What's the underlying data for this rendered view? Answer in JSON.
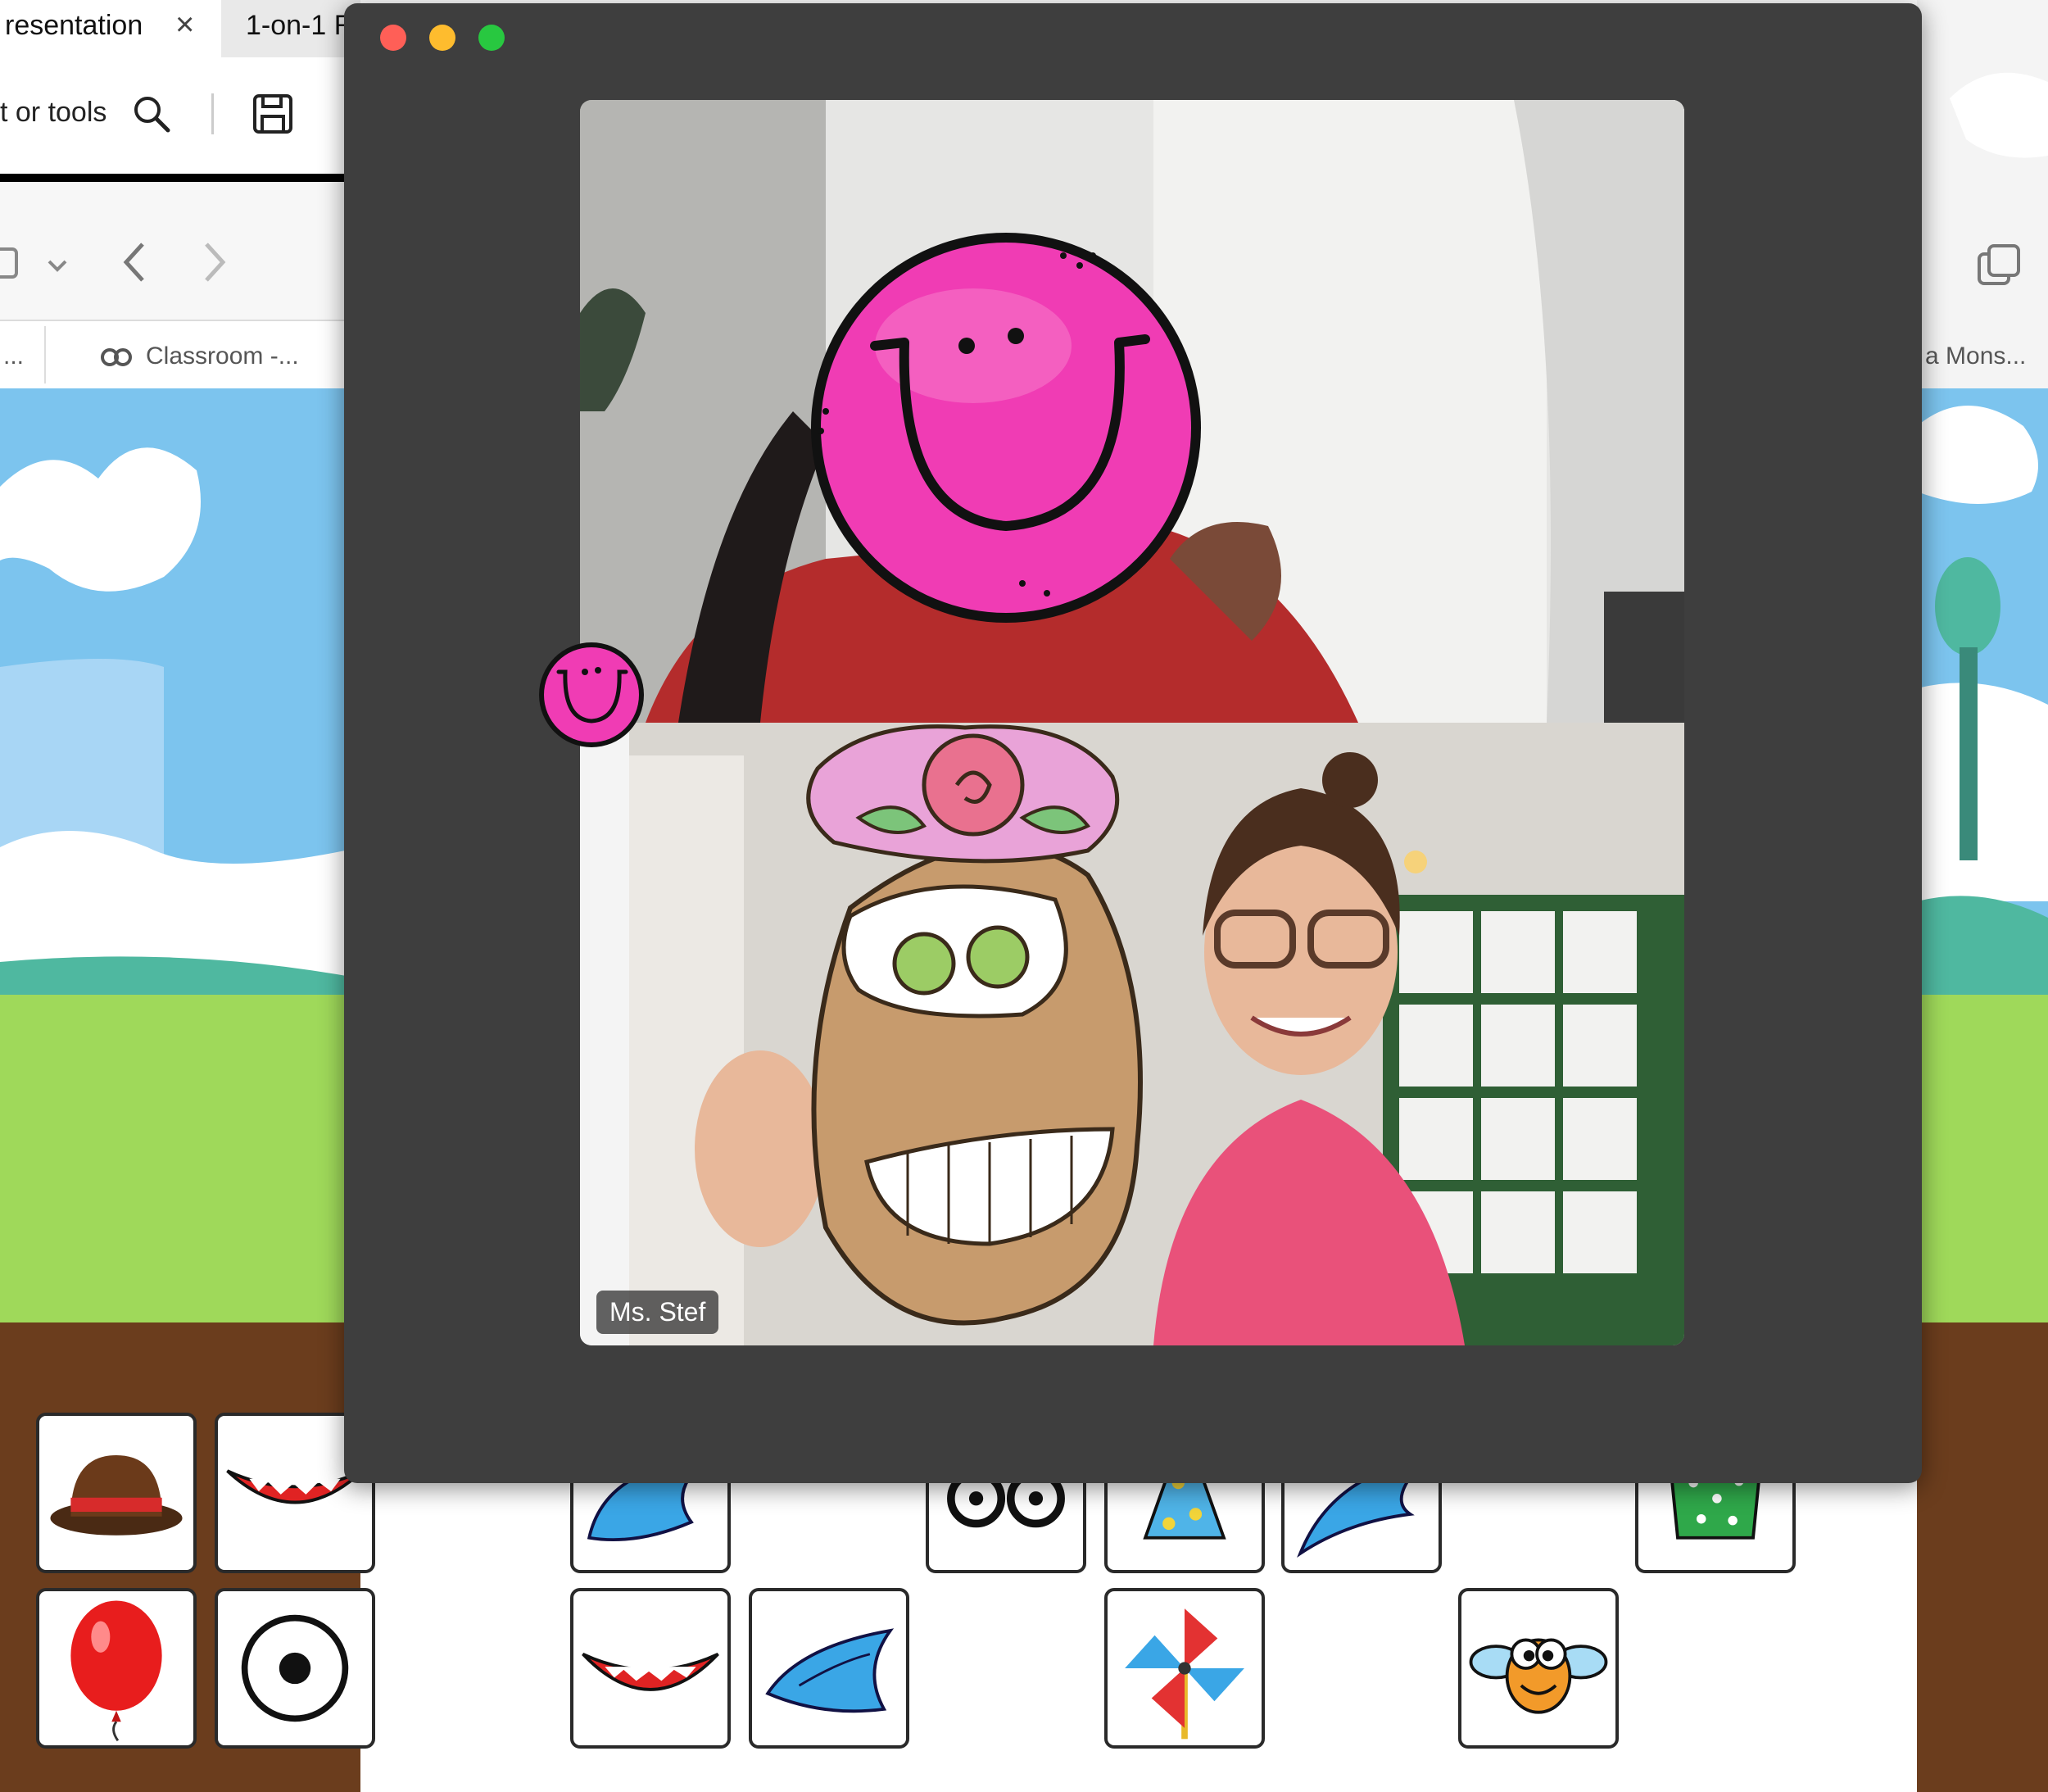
{
  "browser_left": {
    "tabs": [
      {
        "label": "resentation",
        "active": true
      },
      {
        "label": "1-on-1 R"
      }
    ],
    "search_text": "t or tools",
    "bookmark": "Classroom -...",
    "bookmark_prefix": "..."
  },
  "browser_right": {
    "bookmark": "a Mons..."
  },
  "call": {
    "participant_bottom": {
      "name": "Ms. Stef"
    }
  },
  "tray_items": [
    "bowler-hat-icon",
    "monster-mouth-icon",
    "blue-fin-icon",
    "glasses-icon",
    "party-hat-icon",
    "blue-wing-icon",
    "green-pot-icon",
    "red-balloon-icon",
    "eye-icon",
    "monster-mouth-icon",
    "blue-fin-icon",
    "pinwheel-icon",
    "bug-face-icon"
  ],
  "colors": {
    "window_bg": "#3e3e3e",
    "close": "#ff5f57",
    "minimize": "#febc2e",
    "zoom": "#28c840",
    "smiley_pink": "#f03cb4",
    "sky": "#7cc4ee",
    "grass": "#9fd95a",
    "dirt": "#6b3d1d"
  }
}
